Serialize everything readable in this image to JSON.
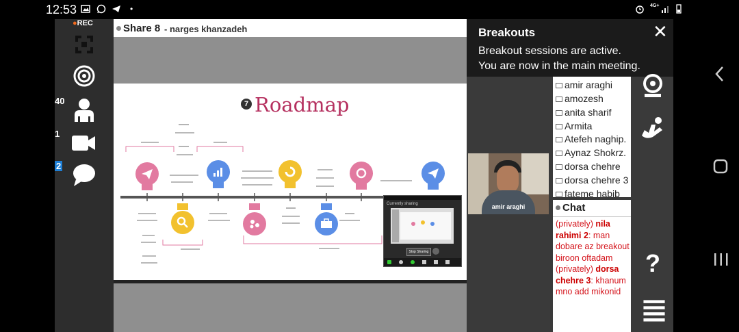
{
  "statusbar": {
    "time": "12:53",
    "network": "4G+"
  },
  "toolbar": {
    "rec_label": "REC",
    "participants_count": "40",
    "video_count": "1",
    "chat_count": "2"
  },
  "share": {
    "title": "Share 8",
    "presenter": "- narges khanzadeh"
  },
  "slide": {
    "number": "7",
    "title": "Roadmap"
  },
  "breakouts": {
    "title": "Breakouts",
    "line1": "Breakout sessions are active.",
    "line2": "You are now in the main meeting.",
    "close": "✕"
  },
  "participants": [
    "amir araghi",
    "amozesh",
    "anita sharif",
    "Armita",
    "Atefeh naghip.",
    "Aynaz Shokrz.",
    "dorsa chehre",
    "dorsa chehre 3",
    "fateme habib"
  ],
  "video": {
    "name": "amir araghi"
  },
  "chat": {
    "title": "Chat",
    "messages": [
      {
        "prefix": "(privately) ",
        "sender": "nila rahimi 2",
        "text": ": man dobare az breakout biroon oftadam"
      },
      {
        "prefix": "(privately) ",
        "sender": "dorsa chehre 3",
        "text": ": khanum mno add mikonid"
      }
    ]
  },
  "minimeeting": {
    "title": "Currently sharing",
    "stop_label": "Stop Sharing"
  },
  "icons": {
    "left": [
      "grid-icon",
      "target-icon",
      "participants-icon",
      "camera-icon",
      "chat-icon"
    ],
    "right": [
      "webcam-icon",
      "raise-hand-icon",
      "help-icon",
      "menu-icon"
    ],
    "nav": [
      "back-icon",
      "home-icon",
      "recents-icon"
    ]
  },
  "colors": {
    "accent_red": "#d4121a",
    "slide_title": "#b5305f",
    "bulb_pink": "#e27aa0",
    "bulb_blue": "#5b8ee6",
    "bulb_yellow": "#f2c12e",
    "chat_badge": "#1e7fd6"
  }
}
